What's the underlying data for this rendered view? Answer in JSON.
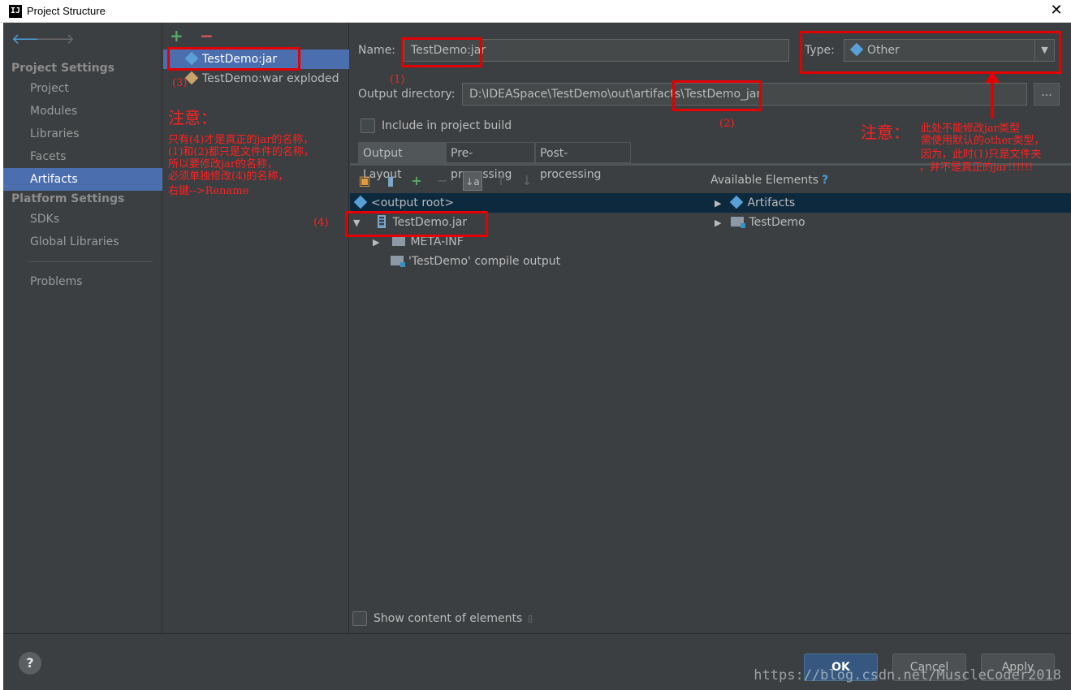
{
  "window": {
    "title": "Project Structure",
    "app_icon": "IJ",
    "close": "✕"
  },
  "nav": {
    "back": "🡐",
    "forward": "🡒",
    "group_project_settings": "Project Settings",
    "items_project": [
      "Project",
      "Modules",
      "Libraries",
      "Facets",
      "Artifacts"
    ],
    "group_platform_settings": "Platform Settings",
    "items_platform": [
      "SDKs",
      "Global Libraries"
    ],
    "problems": "Problems",
    "selected": "Artifacts"
  },
  "artifacts": {
    "add": "+",
    "remove": "−",
    "items": [
      "TestDemo:jar",
      "TestDemo:war exploded"
    ]
  },
  "editor": {
    "name_label": "Name:",
    "name_value": "TestDemo:jar",
    "type_label": "Type:",
    "type_value": "Other",
    "output_dir_label": "Output directory:",
    "output_dir_value": "D:\\IDEASpace\\TestDemo\\out\\artifacts\\TestDemo_jar",
    "browse": "...",
    "include_build": "Include in project build",
    "tabs": [
      "Output Layout",
      "Pre-processing",
      "Post-processing"
    ],
    "available_elements": "Available Elements",
    "help_q": "?",
    "tree_left": [
      "<output root>",
      "TestDemo.jar",
      "META-INF",
      "'TestDemo' compile output"
    ],
    "tree_right": [
      "Artifacts",
      "TestDemo"
    ],
    "show_content": "Show content of elements"
  },
  "buttons": {
    "ok": "OK",
    "cancel": "Cancel",
    "apply": "Apply",
    "help": "?"
  },
  "annotations": {
    "n1": "(1)",
    "n2": "(2)",
    "n3": "(3)",
    "n4": "(4)",
    "note_title_left": "注意：",
    "note_left": [
      "只有(4)才是真正的jar的名称，",
      "(1)和(2)都只是文件件的名称，",
      "所以要修改jar的名称，",
      "必须单独修改(4)的名称，",
      "右键-->Rename"
    ],
    "note_title_right": "注意：",
    "note_right": [
      "此处不能修改jar类型",
      "需使用默认的other类型，",
      "因为，此时(1)只是文件夹",
      "，并不是真正的jar!!!!!!"
    ],
    "watermark": "https://blog.csdn.net/MuscleCoder2018"
  }
}
